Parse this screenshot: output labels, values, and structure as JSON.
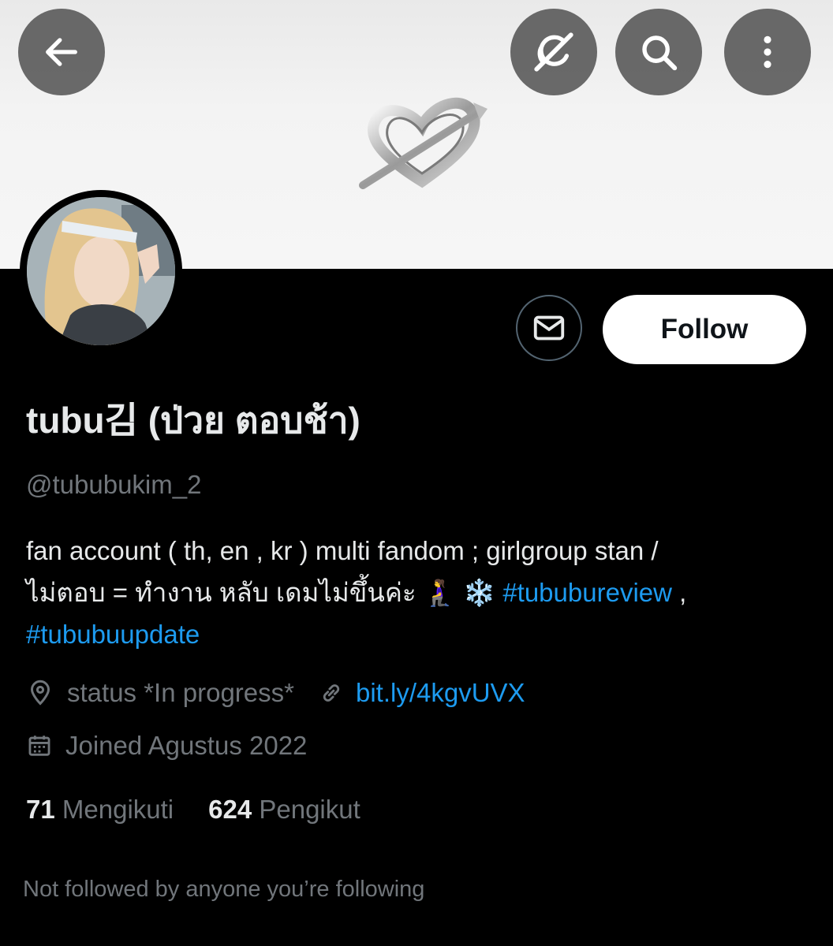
{
  "profile": {
    "display_name": "tubu김 (ป่วย ตอบช้า)",
    "handle": "@tububukim_2",
    "bio": {
      "line1": "fan account ( th, en , kr ) multi fandom ; girlgroup stan /",
      "line2_prefix": "ไม่ตอบ = ทำงาน หลับ เดมไม่ขึ้นค่ะ 🧎‍♀️ ❄️ ",
      "hashtag1": "#tububureview",
      "separator": " ,",
      "hashtag2": "#tububuupdate"
    },
    "location": "status *In progress*",
    "link": "bit.ly/4kgvUVX",
    "joined": "Joined Agustus 2022",
    "following_count": "71",
    "following_label": "Mengikuti",
    "followers_count": "624",
    "followers_label": "Pengikut",
    "not_followed_text": "Not followed by anyone you’re following"
  },
  "actions": {
    "follow_label": "Follow"
  },
  "icons": {
    "back": "back-arrow-icon",
    "grok": "grok-icon",
    "search": "search-icon",
    "more": "more-vertical-icon",
    "message": "envelope-icon",
    "location": "location-pin-icon",
    "link": "link-icon",
    "calendar": "calendar-icon"
  },
  "colors": {
    "background": "#000000",
    "primary_text": "#e7e9ea",
    "secondary_text": "#71767b",
    "accent": "#1d9bf0",
    "follow_button": "#ffffff"
  }
}
